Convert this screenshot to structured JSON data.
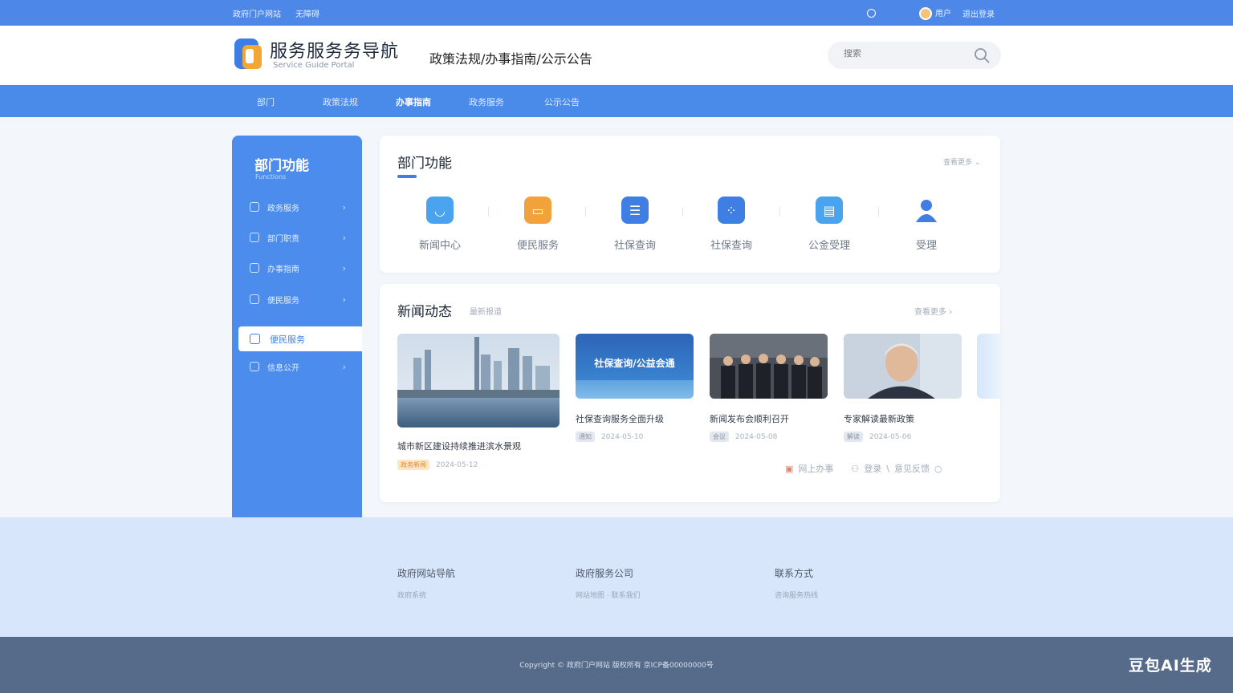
{
  "topbar": {
    "left_text": "政府门户网站",
    "left_link": "无障碍",
    "user_name": "用户",
    "login_text": "退出登录"
  },
  "header": {
    "title": "服务服务务导航",
    "subtitle": "Service Guide Portal",
    "links": "政策法规/办事指南/公示公告",
    "search_placeholder": "搜索"
  },
  "nav": {
    "items": [
      "部门",
      "政策法规",
      "办事指南",
      "政务服务",
      "公示公告"
    ],
    "active_index": 2
  },
  "sidebar": {
    "title": "部门功能",
    "subtitle": "Functions",
    "items": [
      "政务服务",
      "部门职责",
      "办事指南",
      "便民服务",
      "便民服务",
      "信息公开"
    ],
    "active_index": 4
  },
  "functions": {
    "title": "部门功能",
    "more": "查看更多",
    "items": [
      {
        "label": "新闻中心",
        "icon": "message-icon",
        "color": "#4aa3ef"
      },
      {
        "label": "便民服务",
        "icon": "chat-icon",
        "color": "#f2a23a"
      },
      {
        "label": "社保查询",
        "icon": "list-icon",
        "color": "#3f7fe4"
      },
      {
        "label": "社保查询",
        "icon": "apps-icon",
        "color": "#3f7fe4"
      },
      {
        "label": "公金受理",
        "icon": "folder-icon",
        "color": "#4aa3ef"
      },
      {
        "label": "受理",
        "icon": "user-icon",
        "color": "#3f7fe4"
      }
    ]
  },
  "news": {
    "title": "新闻动态",
    "subtitle": "最新报道",
    "more": "查看更多",
    "items": [
      {
        "caption": "城市新区建设持续推进滨水景观",
        "tag": "政务新闻",
        "tag_style": "orange",
        "meta": "2024-05-12"
      },
      {
        "caption": "社保查询服务全面升级",
        "tag": "通知",
        "tag_style": "grey",
        "meta": "2024-05-10",
        "banner": "社保查询/公益会通"
      },
      {
        "caption": "新闻发布会顺利召开",
        "tag": "会议",
        "tag_style": "grey",
        "meta": "2024-05-08"
      },
      {
        "caption": "专家解读最新政策",
        "tag": "解读",
        "tag_style": "grey",
        "meta": "2024-05-06"
      }
    ],
    "actions": {
      "share": "网上办事",
      "user": "登录",
      "feedback": "意见反馈"
    }
  },
  "footer": {
    "cols": [
      {
        "head": "政府网站导航",
        "sub": "政府系统"
      },
      {
        "head": "政府服务公司",
        "sub": "网站地图 · 联系我们"
      },
      {
        "head": "联系方式",
        "sub": "咨询服务热线"
      }
    ],
    "copyright": "Copyright © 政府门户网站 版权所有 京ICP备00000000号",
    "watermark": "豆包AI生成"
  },
  "colors": {
    "brand": "#4a8bea",
    "accent": "#f2a634",
    "footer": "#566a89"
  }
}
